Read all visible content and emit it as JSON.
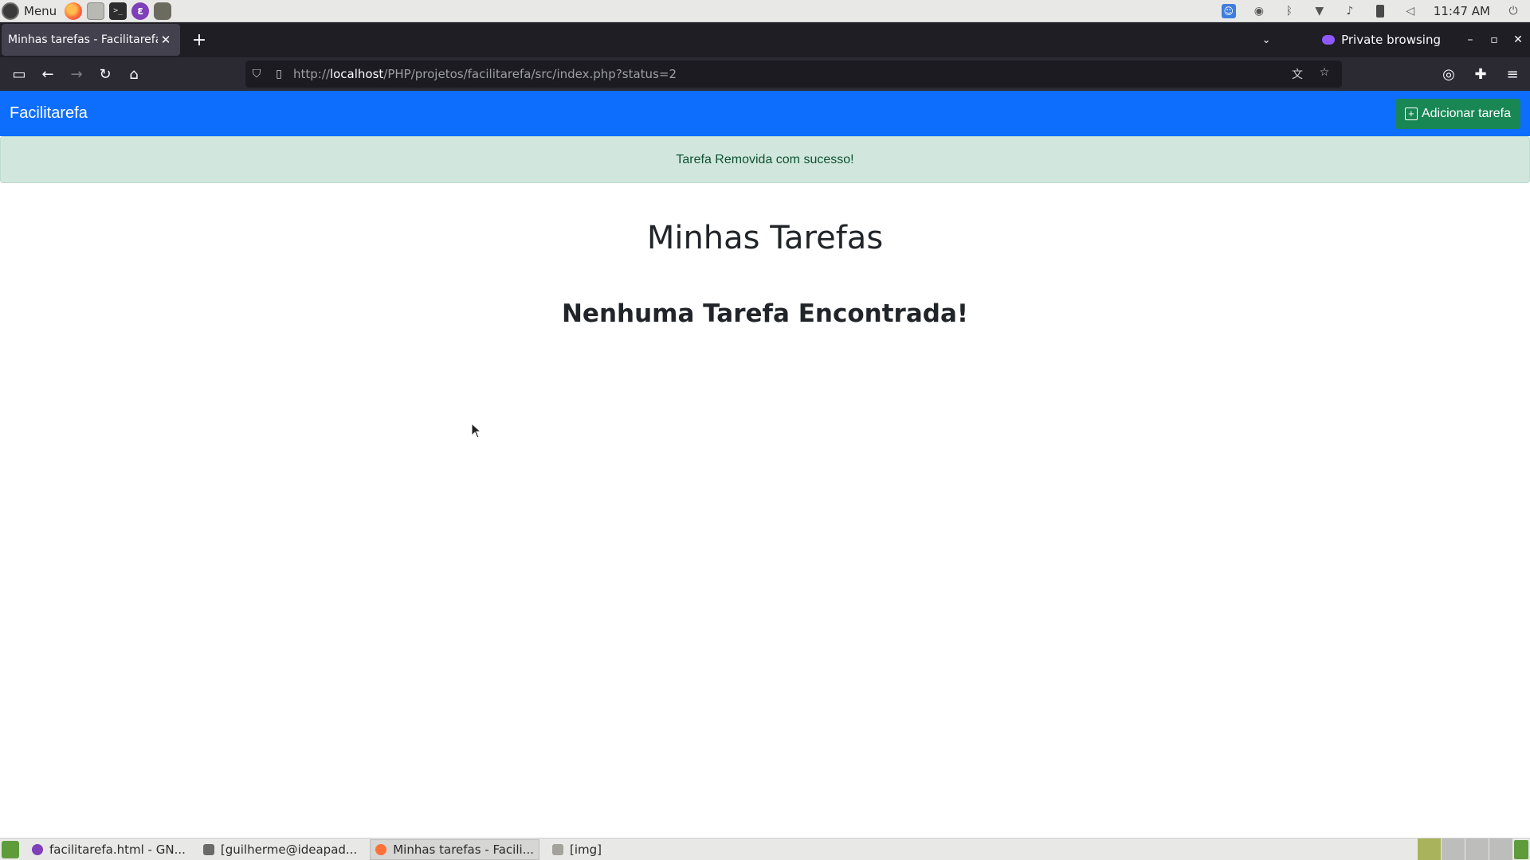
{
  "os_panel": {
    "menu_label": "Menu",
    "clock": "11:47 AM"
  },
  "browser": {
    "tab_title": "Minhas tarefas - Facilitarefa",
    "tab_close": "✕",
    "new_tab": "+",
    "private_label": "Private browsing",
    "url_scheme": "http://",
    "url_host": "localhost",
    "url_path": "/PHP/projetos/facilitarefa/src/index.php?status=2"
  },
  "app": {
    "brand": "Facilitarefa",
    "add_button_label": "Adicionar tarefa",
    "alert_message": "Tarefa Removida com sucesso!",
    "page_title": "Minhas Tarefas",
    "empty_message": "Nenhuma Tarefa Encontrada!",
    "colors": {
      "navbar": "#0d6efd",
      "add_button": "#198754",
      "alert_bg": "#d1e7dd",
      "alert_text": "#0f5132"
    }
  },
  "taskbar": {
    "tasks": [
      {
        "label": "facilitarefa.html - GN...",
        "icon": "emacs-icon"
      },
      {
        "label": "[guilherme@ideapad...",
        "icon": "terminal-icon"
      },
      {
        "label": "Minhas tarefas - Facili...",
        "icon": "firefox-icon"
      },
      {
        "label": "[img]",
        "icon": "folder-icon"
      }
    ]
  }
}
